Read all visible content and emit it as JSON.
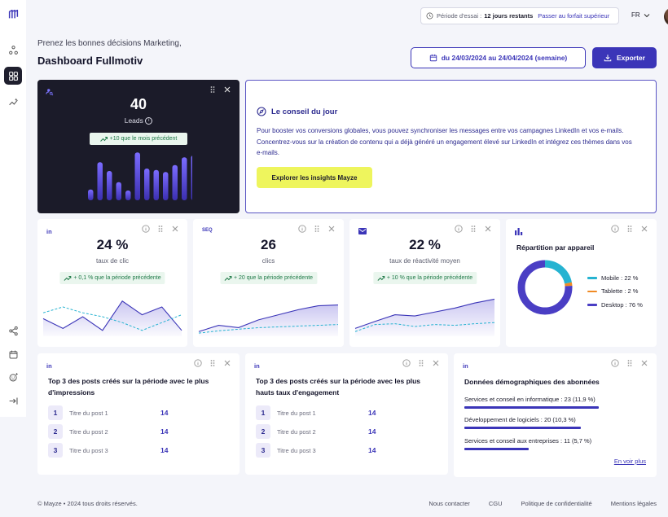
{
  "app": {
    "logo_icon": "mayze-logo-icon",
    "accent": "#3b35b8",
    "dark_card": "#1b1b29"
  },
  "sidebar": {
    "items": [
      {
        "icon": "nodes-icon"
      },
      {
        "icon": "dashboard-grid-icon",
        "active": true
      },
      {
        "icon": "sparkle-chart-icon"
      },
      {
        "icon": "share-icon"
      },
      {
        "icon": "calendar-icon"
      },
      {
        "icon": "emoji-add-icon"
      },
      {
        "icon": "collapse-arrow-icon"
      }
    ]
  },
  "header": {
    "trial_prefix": "Période d'essai :",
    "trial_remaining": "12 jours restants",
    "trial_upgrade": "Passer au forfait supérieur",
    "language": "FR",
    "greeting": "Prenez les bonnes décisions Marketing,",
    "title": "Dashboard Fullmotiv",
    "date_range": "du 24/03/2024 au 24/04/2024 (semaine)",
    "export_label": "Exporter"
  },
  "leads": {
    "value": "40",
    "label": "Leads",
    "badge": "+10 que le mois précédent",
    "bars": [
      0.22,
      0.78,
      0.6,
      0.37,
      0.2,
      0.98,
      0.65,
      0.62,
      0.58,
      0.72,
      0.88,
      0.92
    ]
  },
  "tip": {
    "title": "Le conseil du jour",
    "body": "Pour booster vos conversions globales, vous pouvez synchroniser les messages entre vos campagnes LinkedIn et vos e-mails. Concentrez-vous sur la création de contenu qui a déjà généré un engagement élevé sur LinkedIn et intégrez ces thèmes dans vos e-mails.",
    "button": "Explorer les insights Mayze"
  },
  "kpis": [
    {
      "source": "in",
      "value": "24 %",
      "label": "taux de clic",
      "badge": "+ 0,1 % que la période précédente",
      "current": [
        0.45,
        0.2,
        0.5,
        0.15,
        0.9,
        0.55,
        0.75,
        0.15
      ],
      "previous": [
        0.6,
        0.75,
        0.6,
        0.5,
        0.35,
        0.15,
        0.35,
        0.55
      ]
    },
    {
      "source": "SEQ",
      "value": "26",
      "label": "clics",
      "badge": "+ 20 que la période précédente",
      "current": [
        0.12,
        0.28,
        0.22,
        0.42,
        0.55,
        0.68,
        0.78,
        0.8
      ],
      "previous": [
        0.08,
        0.14,
        0.18,
        0.22,
        0.24,
        0.26,
        0.28,
        0.3
      ]
    },
    {
      "source": "mail",
      "value": "22 %",
      "label": "taux de réactivité moyen",
      "badge": "+ 10 % que la période précédente",
      "current": [
        0.2,
        0.38,
        0.55,
        0.52,
        0.62,
        0.72,
        0.85,
        0.95
      ],
      "previous": [
        0.12,
        0.3,
        0.32,
        0.25,
        0.3,
        0.28,
        0.32,
        0.35
      ]
    }
  ],
  "devices": {
    "title": "Répartition par appareil",
    "items": [
      {
        "label": "Mobile : 22 %",
        "value": 22,
        "color": "#26b3d1"
      },
      {
        "label": "Tablette : 2 %",
        "value": 2,
        "color": "#f08a24"
      },
      {
        "label": "Desktop : 76 %",
        "value": 76,
        "color": "#4a3ec4"
      }
    ]
  },
  "posts_impressions": {
    "title": "Top 3 des posts créés sur la période avec le plus d'impressions",
    "rows": [
      {
        "num": "1",
        "name": "Titre du post 1",
        "value": "14"
      },
      {
        "num": "2",
        "name": "Titre du post 2",
        "value": "14"
      },
      {
        "num": "3",
        "name": "Titre du post 3",
        "value": "14"
      }
    ]
  },
  "posts_engagement": {
    "title": "Top 3 des posts créés sur la période avec les plus hauts taux d'engagement",
    "rows": [
      {
        "num": "1",
        "name": "Titre du post 1",
        "value": "14"
      },
      {
        "num": "2",
        "name": "Titre du post 2",
        "value": "14"
      },
      {
        "num": "3",
        "name": "Titre du post 3",
        "value": "14"
      }
    ]
  },
  "demographics": {
    "title": "Données démographiques des abonnées",
    "rows": [
      {
        "label": "Services et conseil en informatique : 23 (11,9 %)",
        "share": 11.9
      },
      {
        "label": "Développement de logiciels : 20 (10,3 %)",
        "share": 10.3
      },
      {
        "label": "Services et conseil aux entreprises : 11 (5,7 %)",
        "share": 5.7
      }
    ],
    "see_more": "En voir plus"
  },
  "footer": {
    "copyright": "© Mayze • 2024 tous droits réservés.",
    "links": [
      "Nous contacter",
      "CGU",
      "Politique de confidentialité",
      "Mentions légales"
    ]
  }
}
